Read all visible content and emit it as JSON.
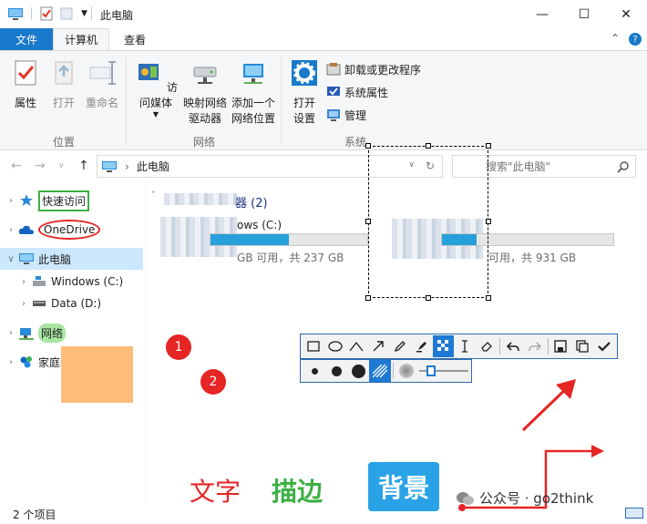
{
  "window": {
    "title": "此电脑",
    "minimize_glyph": "—",
    "maximize_glyph": "☐",
    "close_glyph": "✕"
  },
  "tabs": {
    "file": "文件",
    "computer": "计算机",
    "view": "查看"
  },
  "ribbon": {
    "location": {
      "label": "位置",
      "properties": "属性",
      "open": "打开",
      "rename": "重命名"
    },
    "network": {
      "label": "网络",
      "access_media": "访问媒体",
      "map_drive_1": "映射网络",
      "map_drive_2": "驱动器",
      "add_location_1": "添加一个",
      "add_location_2": "网络位置"
    },
    "system": {
      "label": "系统",
      "open_settings_1": "打开",
      "open_settings_2": "设置",
      "uninstall": "卸载或更改程序",
      "system_properties": "系统属性",
      "manage": "管理"
    }
  },
  "address": {
    "path": "此电脑",
    "search_placeholder": "搜索\"此电脑\""
  },
  "nav": {
    "quick_access": "快速访问",
    "onedrive": "OneDrive",
    "this_pc": "此电脑",
    "windows_c": "Windows (C:)",
    "data_d": "Data (D:)",
    "network": "网络",
    "homegroup": "家庭组"
  },
  "main": {
    "section_count": "器 (2)",
    "drive_c_name": "ows (C:)",
    "drive_c_space": "GB 可用，共 237 GB",
    "drive_c_used": 0.5,
    "drive_d_space": "可用，共 931 GB",
    "drive_d_used": 0.2
  },
  "annotations": {
    "num1": "1",
    "num2": "2",
    "text_label": "文字",
    "stroke_label": "描边",
    "background_label": "背景",
    "watermark": "公众号 · go2think"
  },
  "status": {
    "items": "2 个项目"
  },
  "colors": {
    "accent": "#1979ca",
    "annotation_red": "#e62525",
    "highlight_green": "#3cb043",
    "highlight_orange": "#ffbc7a"
  }
}
